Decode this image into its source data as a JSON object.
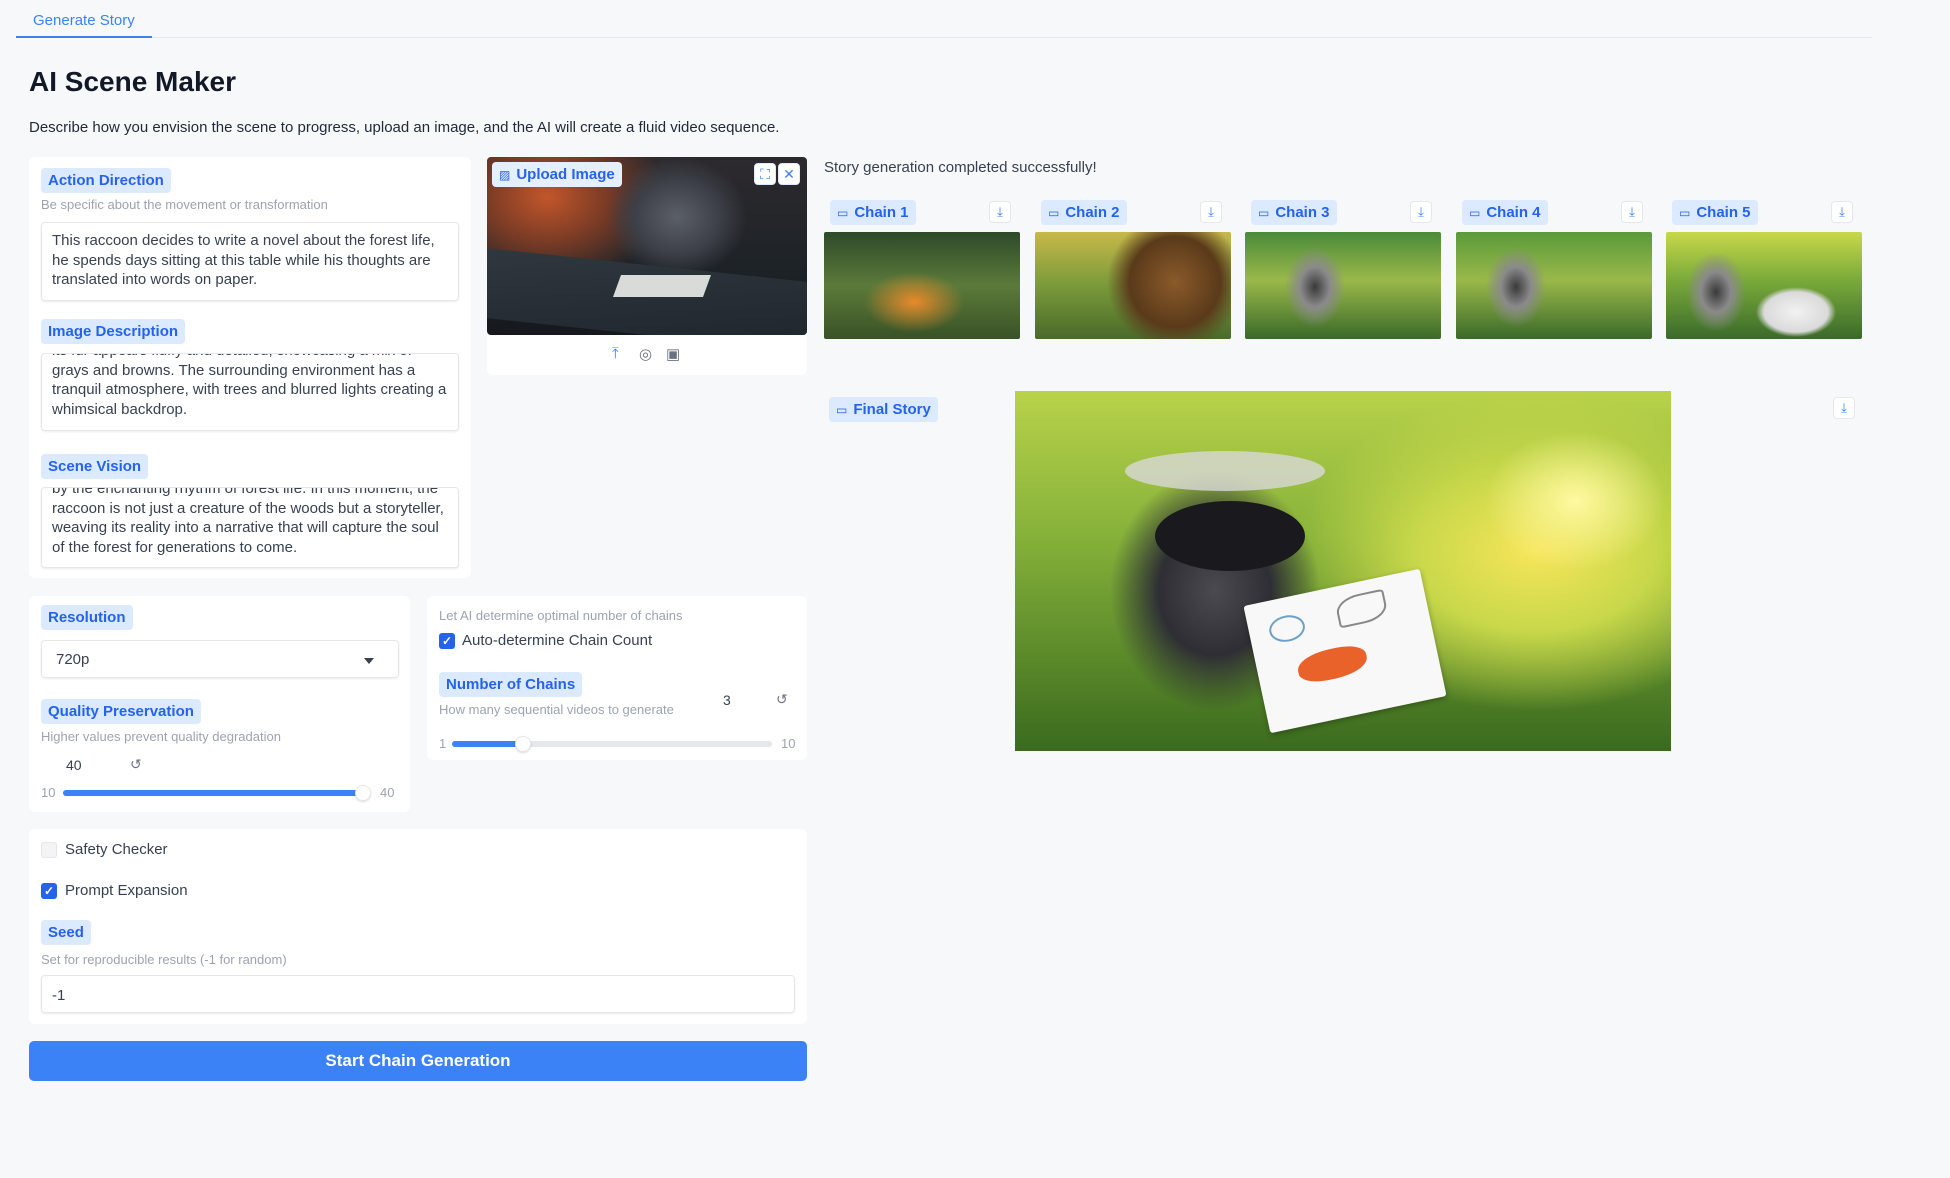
{
  "tabs": [
    {
      "label": "Generate Story"
    }
  ],
  "page": {
    "title": "AI Scene Maker",
    "description": "Describe how you envision the scene to progress, upload an image, and the AI will create a fluid video sequence."
  },
  "action_direction": {
    "label": "Action Direction",
    "info": "Be specific about the movement or transformation",
    "value": "This raccoon decides to write a novel about the forest life, he spends days sitting at this table while his thoughts are translated into words on paper."
  },
  "image_description": {
    "label": "Image Description",
    "value": "its fur appears fluffy and detailed, showcasing a mix of grays and browns. The surrounding environment has a tranquil atmosphere, with trees and blurred lights creating a whimsical backdrop."
  },
  "scene_vision": {
    "label": "Scene Vision",
    "value": "by the enchanting rhythm of forest life. In this moment, the raccoon is not just a creature of the woods but a storyteller, weaving its reality into a narrative that will capture the soul of the forest for generations to come."
  },
  "upload": {
    "label": "Upload Image",
    "icons": [
      "fullscreen-icon",
      "close-icon",
      "upload-icon",
      "webcam-icon",
      "clipboard-icon"
    ]
  },
  "resolution": {
    "label": "Resolution",
    "value": "720p"
  },
  "quality": {
    "label": "Quality Preservation",
    "info": "Higher values prevent quality degradation",
    "value": "40",
    "min": "10",
    "max": "40",
    "fraction": 1.0
  },
  "chains_config": {
    "auto_info": "Let AI determine optimal number of chains",
    "auto_label": "Auto-determine Chain Count",
    "auto_checked": true,
    "num_label": "Number of Chains",
    "num_info": "How many sequential videos to generate",
    "value": "3",
    "min": "1",
    "max": "10",
    "fraction": 0.222
  },
  "options": {
    "safety_label": "Safety Checker",
    "safety_checked": false,
    "prompt_label": "Prompt Expansion",
    "prompt_checked": true,
    "seed_label": "Seed",
    "seed_info": "Set for reproducible results (-1 for random)",
    "seed_value": "-1"
  },
  "start_button": "Start Chain Generation",
  "status": "Story generation completed successfully!",
  "chains": [
    {
      "label": "Chain 1"
    },
    {
      "label": "Chain 2"
    },
    {
      "label": "Chain 3"
    },
    {
      "label": "Chain 4"
    },
    {
      "label": "Chain 5"
    }
  ],
  "final_story": {
    "label": "Final Story"
  },
  "colors": {
    "accent": "#3b82f6",
    "label_bg": "#dbeafe",
    "page_bg": "#f7f8fa"
  }
}
